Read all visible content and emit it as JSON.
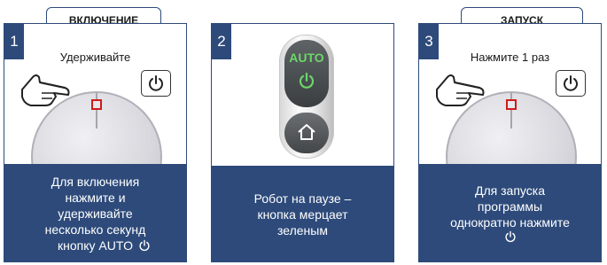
{
  "steps": [
    {
      "number": "1",
      "tab_label": "ВКЛЮЧЕНИЕ",
      "instruction": "Удерживайте",
      "caption": "Для включения\nнажмите и\nудерживайте\nнесколько секунд\nкнопку AUTO",
      "icons": [
        "robot-vacuum",
        "hand-pointer",
        "power-icon"
      ]
    },
    {
      "number": "2",
      "device_label": "AUTO",
      "caption": "Робот на паузе –\nкнопка мерцает\nзеленым",
      "icons": [
        "remote-control",
        "power-icon",
        "home-icon"
      ]
    },
    {
      "number": "3",
      "tab_label": "ЗАПУСК",
      "instruction": "Нажмите 1 раз",
      "caption": "Для запуска\nпрограммы\nоднократно нажмите",
      "icons": [
        "robot-vacuum",
        "hand-pointer",
        "power-icon"
      ]
    }
  ],
  "colors": {
    "panel_blue": "#2d4a7a",
    "highlight_red": "#d11a1a",
    "led_green": "#6cd66a"
  }
}
